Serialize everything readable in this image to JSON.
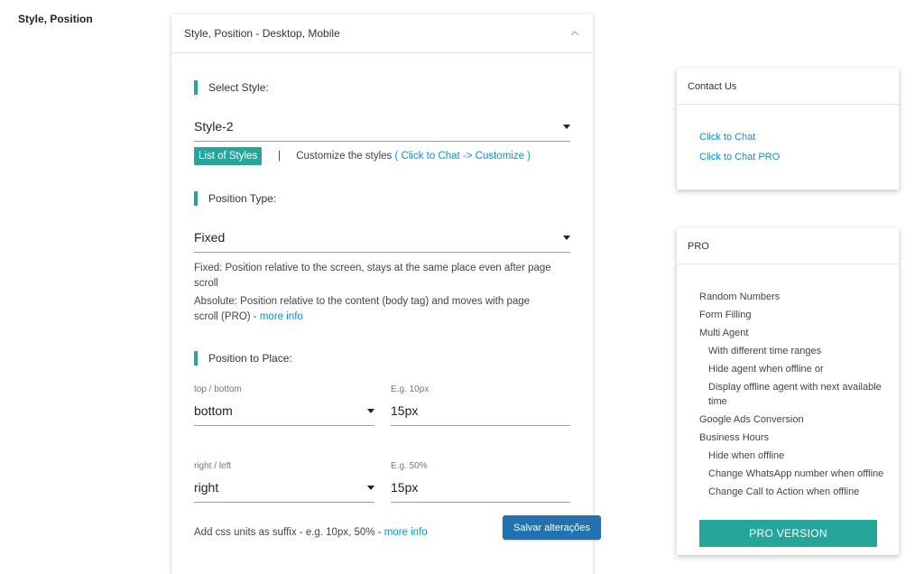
{
  "section": {
    "label": "Style, Position"
  },
  "card": {
    "title": "Style, Position - Desktop, Mobile",
    "select_style": {
      "heading": "Select Style:",
      "value": "Style-2",
      "chip": "List of Styles",
      "separator": "|",
      "customize_text": "Customize the styles",
      "customize_link": "( Click to Chat -> Customize )"
    },
    "position_type": {
      "heading": "Position Type:",
      "value": "Fixed",
      "desc_fixed": "Fixed: Position relative to the screen, stays at the same place even after page scroll",
      "desc_absolute": "Absolute: Position relative to the content (body tag) and moves with page scroll (PRO) -",
      "more_info": "more info"
    },
    "position_place": {
      "heading": "Position to Place:",
      "row1": {
        "select_label": "top / bottom",
        "select_value": "bottom",
        "input_label": "E.g. 10px",
        "input_value": "15px"
      },
      "row2": {
        "select_label": "right / left",
        "select_value": "right",
        "input_label": "E.g. 50%",
        "input_value": "15px"
      },
      "units_text": "Add css units as suffix - e.g. 10px, 50% -",
      "more_info": "more info"
    }
  },
  "save_button": "Salvar alterações",
  "contact": {
    "title": "Contact Us",
    "links": [
      "Click to Chat",
      "Click to Chat PRO"
    ]
  },
  "pro": {
    "title": "PRO",
    "items": [
      {
        "text": "Random Numbers",
        "indent": false
      },
      {
        "text": "Form Filling",
        "indent": false
      },
      {
        "text": "Multi Agent",
        "indent": false
      },
      {
        "text": "With different time ranges",
        "indent": true
      },
      {
        "text": "Hide agent when offline or",
        "indent": true
      },
      {
        "text": "Display offline agent with next available time",
        "indent": true
      },
      {
        "text": "Google Ads Conversion",
        "indent": false
      },
      {
        "text": "Business Hours",
        "indent": false
      },
      {
        "text": "Hide when offline",
        "indent": true
      },
      {
        "text": "Change WhatsApp number when offline",
        "indent": true
      },
      {
        "text": "Change Call to Action when offline",
        "indent": true
      }
    ],
    "button": "PRO VERSION"
  },
  "colors": {
    "accent": "#26a69a",
    "link": "#0e8ce4",
    "primary_button": "#2271b1"
  }
}
